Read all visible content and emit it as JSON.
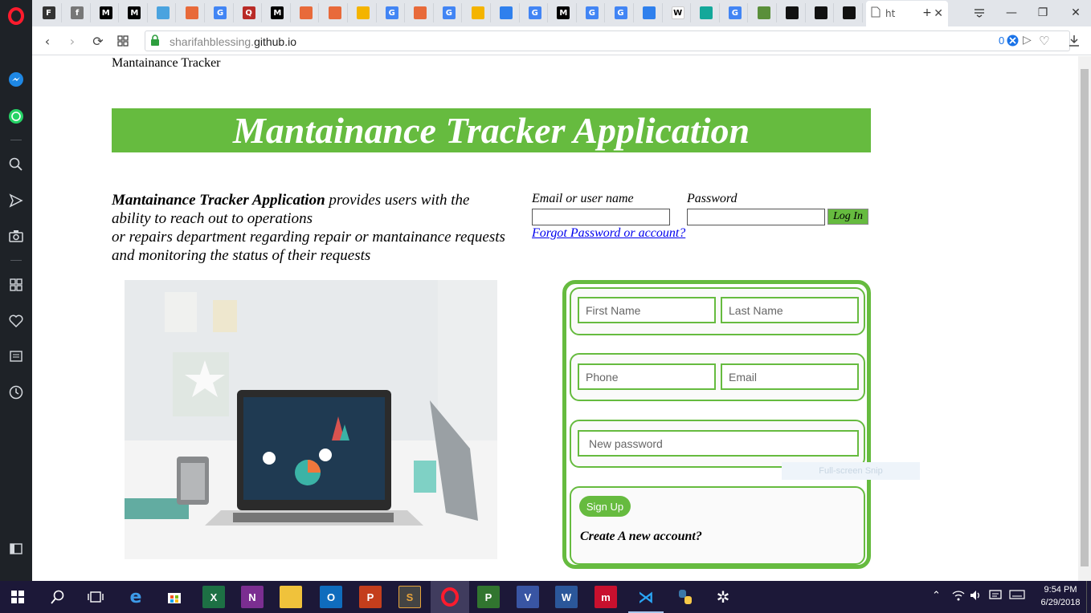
{
  "browser": {
    "tabs": [
      {
        "icon": "terminal-icon",
        "text": "F",
        "bg": "#333333"
      },
      {
        "icon": "document-icon",
        "text": "f",
        "bg": "#777777"
      },
      {
        "icon": "medium-icon",
        "text": "M",
        "bg": "#000000"
      },
      {
        "icon": "medium-icon",
        "text": "M",
        "bg": "#000000"
      },
      {
        "icon": "web-icon",
        "text": "",
        "bg": "#4aa3df"
      },
      {
        "icon": "opera-icon",
        "text": "",
        "bg": "#e86a3a"
      },
      {
        "icon": "google-icon",
        "text": "G",
        "bg": "#4285f4"
      },
      {
        "icon": "quora-icon",
        "text": "Q",
        "bg": "#b92b27"
      },
      {
        "icon": "medium-icon",
        "text": "M",
        "bg": "#000000"
      },
      {
        "icon": "opera-icon",
        "text": "",
        "bg": "#e86a3a"
      },
      {
        "icon": "opera-icon",
        "text": "",
        "bg": "#e86a3a"
      },
      {
        "icon": "photos-icon",
        "text": "",
        "bg": "#f4b400"
      },
      {
        "icon": "google-icon",
        "text": "G",
        "bg": "#4285f4"
      },
      {
        "icon": "opera-icon",
        "text": "",
        "bg": "#e86a3a"
      },
      {
        "icon": "google-icon",
        "text": "G",
        "bg": "#4285f4"
      },
      {
        "icon": "drive-icon",
        "text": "",
        "bg": "#f4b400"
      },
      {
        "icon": "check-icon",
        "text": "",
        "bg": "#2f80ed"
      },
      {
        "icon": "google-icon",
        "text": "G",
        "bg": "#4285f4"
      },
      {
        "icon": "medium-icon",
        "text": "M",
        "bg": "#000000"
      },
      {
        "icon": "google-icon",
        "text": "G",
        "bg": "#4285f4"
      },
      {
        "icon": "google-icon",
        "text": "G",
        "bg": "#4285f4"
      },
      {
        "icon": "link-icon",
        "text": "",
        "bg": "#2f80ed"
      },
      {
        "icon": "wikipedia-icon",
        "text": "W",
        "bg": "#ffffff"
      },
      {
        "icon": "teal-square-icon",
        "text": "",
        "bg": "#14a89a"
      },
      {
        "icon": "google-icon",
        "text": "G",
        "bg": "#4285f4"
      },
      {
        "icon": "circle-icon",
        "text": "",
        "bg": "#5a8f3a"
      },
      {
        "icon": "github-icon",
        "text": "",
        "bg": "#111111"
      },
      {
        "icon": "github-icon",
        "text": "",
        "bg": "#111111"
      },
      {
        "icon": "github-icon",
        "text": "",
        "bg": "#111111"
      }
    ],
    "active_tab_label": "ht",
    "url_dim": "sharifahblessing.",
    "url_main": "github.io",
    "url_counter": "0"
  },
  "page": {
    "brand": "Mantainance Tracker",
    "banner_title": "Mantainance Tracker Application",
    "intro_bold": "Mantainance Tracker Application",
    "intro_line1_rest": " provides users with the ability to reach out to operations",
    "intro_line2": "or repairs department regarding repair or mantainance requests and monitoring the status of their requests",
    "login": {
      "email_label": "Email or user name",
      "password_label": "Password",
      "login_button": "Log In",
      "forgot_link": "Forgot Password or account?"
    },
    "signup": {
      "first_name_placeholder": "First Name",
      "last_name_placeholder": "Last Name",
      "phone_placeholder": "Phone",
      "email_placeholder": "Email",
      "password_placeholder": "New password",
      "signup_button": "Sign Up",
      "create_text": "Create A new account?"
    },
    "snip_hint": "Full-screen Snip"
  },
  "taskbar": {
    "time": "9:54 PM",
    "date": "6/29/2018"
  },
  "colors": {
    "accent_green": "#66bb3f",
    "sidebar_bg": "#1e2227",
    "taskbar_bg": "#1c1838"
  }
}
